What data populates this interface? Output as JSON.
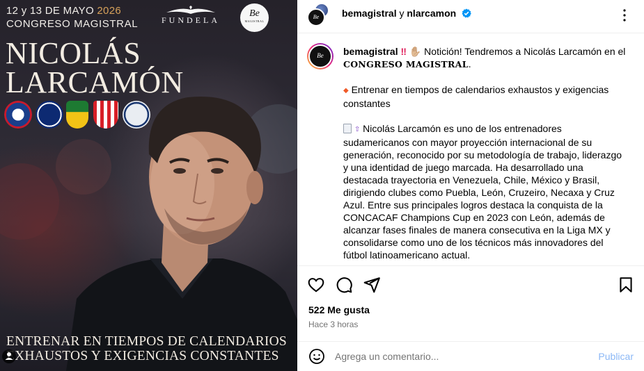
{
  "poster": {
    "date_prefix": "12 y 13  DE MAYO",
    "date_year": "2026",
    "congress": "CONGRESO MAGISTRAL",
    "fundela": "FUNDELA",
    "logo_be": "Be",
    "logo_magistral": "MAGISTRAL",
    "name_line1": "NICOLÁS",
    "name_line2": "LARCAMÓN",
    "tagline_line1": "ENTRENAR EN TIEMPOS DE CALENDARIOS",
    "tagline_line2": "EXHAUSTOS Y EXIGENCIAS CONSTANTES"
  },
  "header": {
    "user1": "bemagistral",
    "conj": "y",
    "user2": "nlarcamon"
  },
  "caption": {
    "username": "bemagistral",
    "intro": "Notición! Tendremos a Nicolás Larcamón en el",
    "intro_bold": "CONGRESO MAGISTRAL",
    "intro_end": ".",
    "topic": "Entrenar en tiempos de calendarios exhaustos y exigencias constantes",
    "bio": "Nicolás Larcamón es uno de los entrenadores sudamericanos con mayor proyección internacional de su generación, reconocido por su metodología de trabajo, liderazgo y una identidad de juego marcada. Ha desarrollado una destacada trayectoria en Venezuela, Chile, México y Brasil, dirigiendo clubes como Puebla, León, Cruzeiro, Necaxa y Cruz Azul. Entre sus principales logros destaca la conquista de la CONCACAF Champions Cup en 2023 con León, además de alcanzar fases finales de manera consecutiva en la Liga MX y consolidarse como uno de los técnicos más innovadores del fútbol latinoamericano actual."
  },
  "stats": {
    "likes": "522 Me gusta",
    "time": "Hace 3 horas"
  },
  "comment": {
    "placeholder": "Agrega un comentario...",
    "publish": "Publicar"
  },
  "colors": {
    "accent_blue": "#0095f6",
    "publish_disabled": "#8cb8f6",
    "verified": "#0095f6",
    "year_gold": "#d6a05a"
  }
}
